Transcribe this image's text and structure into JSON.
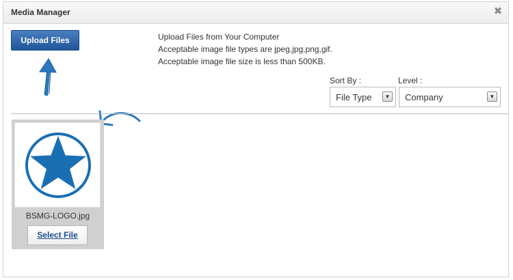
{
  "dialog": {
    "title": "Media Manager",
    "close_glyph": "✖"
  },
  "toolbar": {
    "upload_label": "Upload Files"
  },
  "info": {
    "line1": "Upload Files from Your Computer",
    "line2": "Acceptable image file types are jpeg,jpg,png,gif.",
    "line3": "Acceptable image file size is less than 500KB."
  },
  "filters": {
    "sort_by_label": "Sort By :",
    "sort_by_value": "File Type",
    "level_label": "Level :",
    "level_value": "Company"
  },
  "files": [
    {
      "name": "BSMG-LOGO.jpg",
      "select_label": "Select File",
      "icon": "star-logo-icon"
    }
  ],
  "colors": {
    "accent_blue": "#1f5599",
    "logo_blue": "#1a6fb3",
    "annotation_blue": "#2a78bf"
  }
}
